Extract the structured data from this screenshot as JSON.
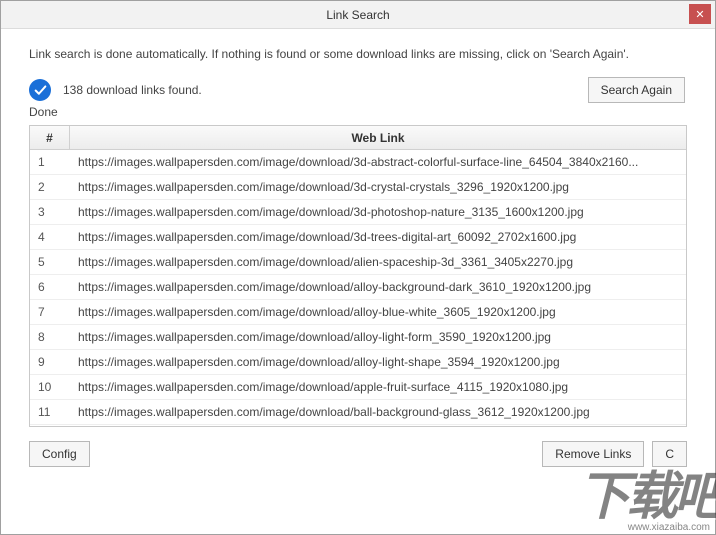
{
  "window": {
    "title": "Link Search"
  },
  "description": "Link search is done automatically. If nothing is found or some download links are missing, click on 'Search Again'.",
  "status": {
    "found_text": "138 download links found.",
    "done_label": "Done"
  },
  "buttons": {
    "search_again": "Search Again",
    "config": "Config",
    "remove_links": "Remove Links",
    "ok_partial": "C"
  },
  "table": {
    "headers": {
      "num": "#",
      "link": "Web Link"
    },
    "rows": [
      {
        "n": "1",
        "url": "https://images.wallpapersden.com/image/download/3d-abstract-colorful-surface-line_64504_3840x2160..."
      },
      {
        "n": "2",
        "url": "https://images.wallpapersden.com/image/download/3d-crystal-crystals_3296_1920x1200.jpg"
      },
      {
        "n": "3",
        "url": "https://images.wallpapersden.com/image/download/3d-photoshop-nature_3135_1600x1200.jpg"
      },
      {
        "n": "4",
        "url": "https://images.wallpapersden.com/image/download/3d-trees-digital-art_60092_2702x1600.jpg"
      },
      {
        "n": "5",
        "url": "https://images.wallpapersden.com/image/download/alien-spaceship-3d_3361_3405x2270.jpg"
      },
      {
        "n": "6",
        "url": "https://images.wallpapersden.com/image/download/alloy-background-dark_3610_1920x1200.jpg"
      },
      {
        "n": "7",
        "url": "https://images.wallpapersden.com/image/download/alloy-blue-white_3605_1920x1200.jpg"
      },
      {
        "n": "8",
        "url": "https://images.wallpapersden.com/image/download/alloy-light-form_3590_1920x1200.jpg"
      },
      {
        "n": "9",
        "url": "https://images.wallpapersden.com/image/download/alloy-light-shape_3594_1920x1200.jpg"
      },
      {
        "n": "10",
        "url": "https://images.wallpapersden.com/image/download/apple-fruit-surface_4115_1920x1080.jpg"
      },
      {
        "n": "11",
        "url": "https://images.wallpapersden.com/image/download/ball-background-glass_3612_1920x1200.jpg"
      }
    ]
  },
  "watermark": {
    "text": "下载吧",
    "url": "www.xiazaiba.com"
  }
}
